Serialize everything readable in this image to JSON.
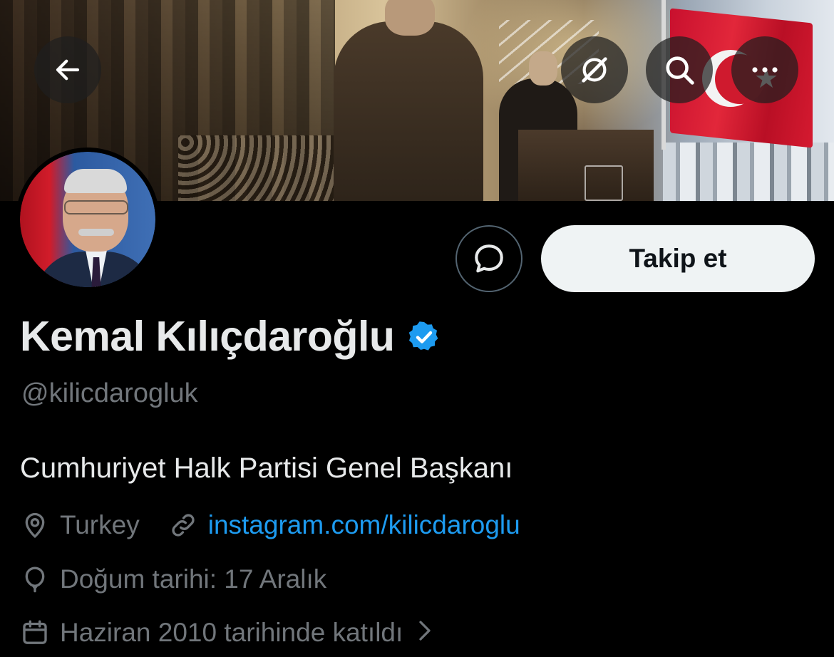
{
  "profile": {
    "name": "Kemal Kılıçdaroğlu",
    "handle": "@kilicdarogluk",
    "bio": "Cumhuriyet Halk Partisi Genel Başkanı",
    "location": "Turkey",
    "link": "instagram.com/kilicdaroglu",
    "birthday": "Doğum tarihi: 17 Aralık",
    "joined": "Haziran 2010 tarihinde katıldı",
    "verified": true
  },
  "actions": {
    "follow_label": "Takip et"
  },
  "icons": {
    "back": "arrow-left-icon",
    "grok": "grok-icon",
    "search": "search-icon",
    "more": "more-dots-icon",
    "message": "message-bubble-icon",
    "location": "map-pin-icon",
    "link": "link-icon",
    "birthday": "balloon-icon",
    "joined": "calendar-icon",
    "chevron": "chevron-right-icon",
    "verified": "verified-badge-icon"
  },
  "colors": {
    "background": "#000000",
    "text_primary": "#e7e9ea",
    "text_secondary": "#71767b",
    "link": "#1d9bf0",
    "verified": "#1d9bf0",
    "follow_button_bg": "#eff3f4"
  }
}
